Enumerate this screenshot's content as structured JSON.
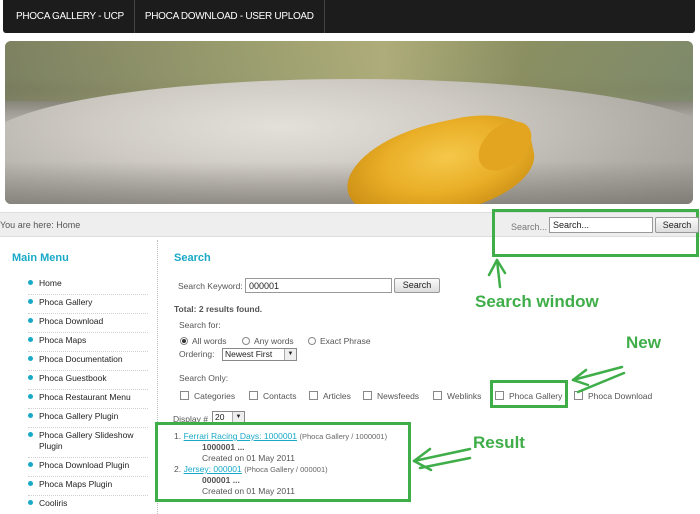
{
  "topnav": {
    "items": [
      {
        "label": "PHOCA GALLERY - UCP"
      },
      {
        "label": "PHOCA DOWNLOAD - USER UPLOAD"
      }
    ]
  },
  "breadcrumb": {
    "text": "You are here: Home"
  },
  "top_search": {
    "label": "Search...",
    "value": "Search...",
    "button": "Search"
  },
  "sidebar": {
    "title": "Main Menu",
    "items": [
      {
        "label": "Home"
      },
      {
        "label": "Phoca Gallery"
      },
      {
        "label": "Phoca Download"
      },
      {
        "label": "Phoca Maps"
      },
      {
        "label": "Phoca Documentation"
      },
      {
        "label": "Phoca Guestbook"
      },
      {
        "label": "Phoca Restaurant Menu"
      },
      {
        "label": "Phoca Gallery Plugin"
      },
      {
        "label": "Phoca Gallery Slideshow Plugin"
      },
      {
        "label": "Phoca Download Plugin"
      },
      {
        "label": "Phoca Maps Plugin"
      },
      {
        "label": "Cooliris"
      }
    ]
  },
  "search": {
    "heading": "Search",
    "keyword_label": "Search Keyword:",
    "keyword_value": "000001",
    "button": "Search",
    "total": "Total: 2 results found.",
    "search_for_label": "Search for:",
    "modes": {
      "all": "All words",
      "any": "Any words",
      "exact": "Exact Phrase"
    },
    "selected_mode": "All words",
    "ordering_label": "Ordering:",
    "ordering_value": "Newest First",
    "search_only_label": "Search Only:",
    "areas": {
      "categories": "Categories",
      "contacts": "Contacts",
      "articles": "Articles",
      "newsfeeds": "Newsfeeds",
      "weblinks": "Weblinks",
      "phoca_gallery": "Phoca Gallery",
      "phoca_download": "Phoca Download"
    },
    "display_label": "Display #",
    "display_value": "20"
  },
  "results": [
    {
      "num": "1.",
      "title": "Ferrari Racing Days: 1000001",
      "section": "(Phoca Gallery / 1000001)",
      "snippet": "1000001 ...",
      "created": "Created on 01 May 2011"
    },
    {
      "num": "2.",
      "title": "Jersey: 000001",
      "section": "(Phoca Gallery / 000001)",
      "snippet": "000001 ...",
      "created": "Created on 01 May 2011"
    }
  ],
  "annotations": {
    "search_window": "Search window",
    "new": "New",
    "result": "Result",
    "color": "#3fae49"
  },
  "colors": {
    "accent": "#19a9c7",
    "nav_bg": "#1c1c1c"
  }
}
